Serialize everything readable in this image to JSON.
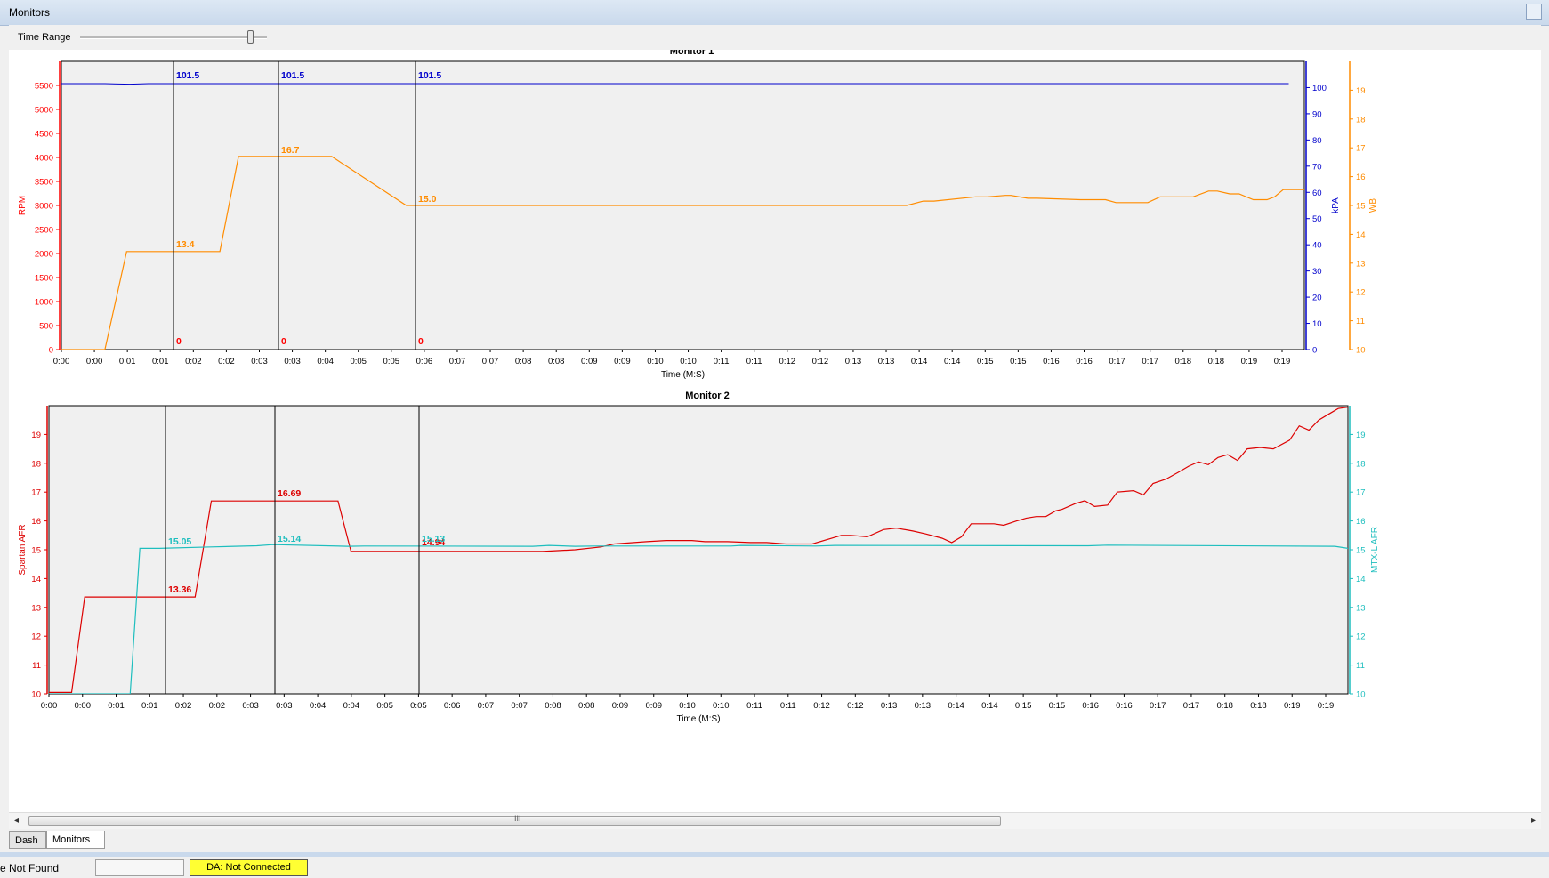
{
  "window": {
    "title": "Monitors"
  },
  "toolbar": {
    "time_range_label": "Time Range",
    "time_range_value": 1.0
  },
  "colors": {
    "rpm": "#ff0000",
    "kpa": "#0000cc",
    "wb": "#ff8c00",
    "spartan": "#dd0000",
    "mtx": "#1ebebe",
    "cursor": "#000000",
    "plot_bg": "#f0f0f0",
    "status_yellow": "#ffff33"
  },
  "chart_data": [
    {
      "type": "line",
      "title": "Monitor 1",
      "xlabel": "Time (M:S)",
      "x_ticks": [
        "0:00",
        "0:00",
        "0:01",
        "0:01",
        "0:02",
        "0:02",
        "0:03",
        "0:03",
        "0:04",
        "0:05",
        "0:05",
        "0:06",
        "0:07",
        "0:07",
        "0:08",
        "0:08",
        "0:09",
        "0:09",
        "0:10",
        "0:10",
        "0:11",
        "0:11",
        "0:12",
        "0:12",
        "0:13",
        "0:13",
        "0:14",
        "0:14",
        "0:15",
        "0:15",
        "0:16",
        "0:16",
        "0:17",
        "0:17",
        "0:18",
        "0:18",
        "0:19",
        "0:19"
      ],
      "xlim": [
        0,
        20
      ],
      "grid": false,
      "axes": [
        {
          "name": "RPM",
          "side": "left",
          "ylim": [
            0,
            6000
          ],
          "ticks": [
            0,
            500,
            1000,
            1500,
            2000,
            2500,
            3000,
            3500,
            4000,
            4500,
            5000,
            5500
          ]
        },
        {
          "name": "kPA",
          "side": "right",
          "ylim": [
            0,
            110
          ],
          "ticks": [
            0,
            10,
            20,
            30,
            40,
            50,
            60,
            70,
            80,
            90,
            100
          ]
        },
        {
          "name": "WB",
          "side": "right",
          "ylim": [
            10,
            20
          ],
          "ticks": [
            10,
            11,
            12,
            13,
            14,
            15,
            16,
            17,
            18,
            19
          ]
        }
      ],
      "series": [
        {
          "name": "RPM",
          "axis": "RPM",
          "x": [
            0,
            19.75
          ],
          "y": [
            0,
            0
          ]
        },
        {
          "name": "kPA",
          "axis": "kPA",
          "x": [
            0,
            0.7,
            1.1,
            1.4,
            19.75
          ],
          "y": [
            101.5,
            101.5,
            101.3,
            101.5,
            101.5
          ]
        },
        {
          "name": "WB",
          "axis": "WB",
          "x": [
            0,
            0.7,
            1.05,
            2.55,
            2.85,
            4.2,
            4.35,
            5.55,
            5.75,
            7.05,
            13.6,
            13.87,
            14.04,
            14.71,
            14.9,
            15.19,
            15.28,
            15.55,
            15.7,
            16.4,
            16.52,
            16.8,
            16.97,
            17.08,
            17.48,
            17.68,
            17.85,
            18.21,
            18.46,
            18.6,
            18.8,
            18.95,
            19.18,
            19.4,
            19.52,
            19.66,
            19.86,
            20.05,
            20.24,
            20.35,
            20.5,
            20.78,
            20.9,
            21.3,
            21.45,
            21.6,
            21.73,
            21.85,
            22.0,
            22.15,
            22.3,
            22.43,
            22.55,
            22.7,
            22.85,
            23.05,
            23.15,
            23.6,
            23.78,
            23.85,
            23.97,
            24.08,
            24.23,
            24.41,
            24.6
          ],
          "y": [
            10,
            10,
            13.4,
            13.4,
            16.7,
            16.7,
            16.7,
            15.0,
            15.0,
            15.0,
            15.0,
            15.15,
            15.15,
            15.3,
            15.3,
            15.35,
            15.35,
            15.25,
            15.25,
            15.2,
            15.2,
            15.2,
            15.1,
            15.1,
            15.1,
            15.3,
            15.3,
            15.3,
            15.5,
            15.5,
            15.4,
            15.4,
            15.2,
            15.2,
            15.3,
            15.55,
            15.55,
            15.55,
            15.6,
            15.6,
            15.75,
            15.7,
            15.95,
            16.2,
            16.1,
            16.4,
            16.6,
            16.4,
            16.95,
            16.95,
            16.7,
            16.95,
            17.1,
            17.15,
            17.5,
            17.85,
            17.75,
            18.2,
            17.95,
            18.15,
            18.0,
            18.25,
            18.4,
            18.5,
            18.5
          ]
        }
      ],
      "cursors": [
        {
          "x": 1.45,
          "kpa_label": "101.5",
          "wb_label": "13.4",
          "rpm_label": "0"
        },
        {
          "x": 2.8,
          "kpa_label": "101.5",
          "wb_label": "16.7",
          "rpm_label": "0"
        },
        {
          "x": 4.5,
          "kpa_label": "101.5",
          "wb_label": "15.0",
          "rpm_label": "0"
        }
      ]
    },
    {
      "type": "line",
      "title": "Monitor 2",
      "xlabel": "Time (M:S)",
      "x_ticks": [
        "0:00",
        "0:00",
        "0:01",
        "0:01",
        "0:02",
        "0:02",
        "0:03",
        "0:03",
        "0:04",
        "0:04",
        "0:05",
        "0:05",
        "0:06",
        "0:07",
        "0:07",
        "0:08",
        "0:08",
        "0:09",
        "0:09",
        "0:10",
        "0:10",
        "0:11",
        "0:11",
        "0:12",
        "0:12",
        "0:13",
        "0:13",
        "0:14",
        "0:14",
        "0:15",
        "0:15",
        "0:16",
        "0:16",
        "0:17",
        "0:17",
        "0:18",
        "0:18",
        "0:19",
        "0:19"
      ],
      "xlim": [
        0,
        20
      ],
      "grid": false,
      "axes": [
        {
          "name": "Spartan AFR",
          "side": "left",
          "ylim": [
            10,
            20
          ],
          "ticks": [
            10,
            11,
            12,
            13,
            14,
            15,
            16,
            17,
            18,
            19
          ]
        },
        {
          "name": "MTX-L AFR",
          "side": "right",
          "ylim": [
            10,
            20
          ],
          "ticks": [
            10,
            11,
            12,
            13,
            14,
            15,
            16,
            17,
            18,
            19
          ]
        }
      ],
      "series": [
        {
          "name": "Spartan AFR",
          "axis": "Spartan AFR",
          "x": [
            0,
            0.35,
            0.55,
            2.25,
            2.5,
            3.1,
            4.45,
            4.65,
            6.25,
            6.6,
            7.2,
            7.6,
            8.1,
            8.5,
            8.7,
            9.2,
            9.5,
            9.9,
            10.1,
            10.45,
            10.8,
            11.05,
            11.35,
            11.5,
            11.75,
            12.2,
            12.35,
            12.6,
            12.85,
            13.05,
            13.3,
            13.5,
            13.75,
            13.9,
            14.05,
            14.2,
            14.4,
            14.55,
            14.7,
            14.9,
            15.05,
            15.2,
            15.35,
            15.5,
            15.6,
            15.8,
            15.95,
            16.1,
            16.3,
            16.45,
            16.7,
            16.85,
            17.0,
            17.2,
            17.4,
            17.55,
            17.7,
            17.85,
            18.0,
            18.15,
            18.3,
            18.45,
            18.65,
            18.85,
            19.1,
            19.25,
            19.4,
            19.55,
            19.7,
            19.85,
            20.0
          ],
          "y": [
            10.05,
            10.05,
            13.36,
            13.36,
            16.69,
            16.69,
            16.69,
            14.94,
            14.94,
            14.94,
            14.94,
            14.94,
            15.0,
            15.1,
            15.2,
            15.28,
            15.32,
            15.32,
            15.28,
            15.28,
            15.25,
            15.25,
            15.2,
            15.2,
            15.2,
            15.5,
            15.5,
            15.45,
            15.7,
            15.75,
            15.65,
            15.55,
            15.4,
            15.25,
            15.45,
            15.9,
            15.9,
            15.9,
            15.85,
            16.0,
            16.1,
            16.15,
            16.15,
            16.35,
            16.4,
            16.6,
            16.7,
            16.5,
            16.55,
            17.0,
            17.05,
            16.9,
            17.3,
            17.45,
            17.7,
            17.9,
            18.05,
            17.95,
            18.2,
            18.3,
            18.1,
            18.5,
            18.55,
            18.5,
            18.8,
            19.3,
            19.15,
            19.5,
            19.7,
            19.9,
            19.95
          ]
        },
        {
          "name": "MTX-L AFR",
          "axis": "MTX-L AFR",
          "x": [
            0,
            1.25,
            1.4,
            1.7,
            2.5,
            3.2,
            3.45,
            4.6,
            4.85,
            7.45,
            7.7,
            8.1,
            8.4,
            10.5,
            10.65,
            11.8,
            12.1,
            16.0,
            16.3,
            19.8,
            20.0
          ],
          "y": [
            10,
            10,
            15.05,
            15.05,
            15.1,
            15.14,
            15.18,
            15.12,
            15.13,
            15.12,
            15.15,
            15.12,
            15.13,
            15.13,
            15.15,
            15.13,
            15.15,
            15.14,
            15.16,
            15.12,
            15.05
          ]
        }
      ],
      "cursors": [
        {
          "x": 1.7,
          "spartan_label": "13.36",
          "mtx_label": "15.05"
        },
        {
          "x": 3.5,
          "spartan_label": "16.69",
          "mtx_label": "15.14"
        },
        {
          "x": 5.75,
          "spartan_label": "14.94",
          "mtx_label": "15.13"
        }
      ]
    }
  ],
  "scrollbar": {
    "grip": "III"
  },
  "tabs": [
    {
      "label": "Dash"
    },
    {
      "label": "Monitors"
    }
  ],
  "status": {
    "left_text": "e Not Found",
    "da_text": "DA: Not Connected"
  }
}
